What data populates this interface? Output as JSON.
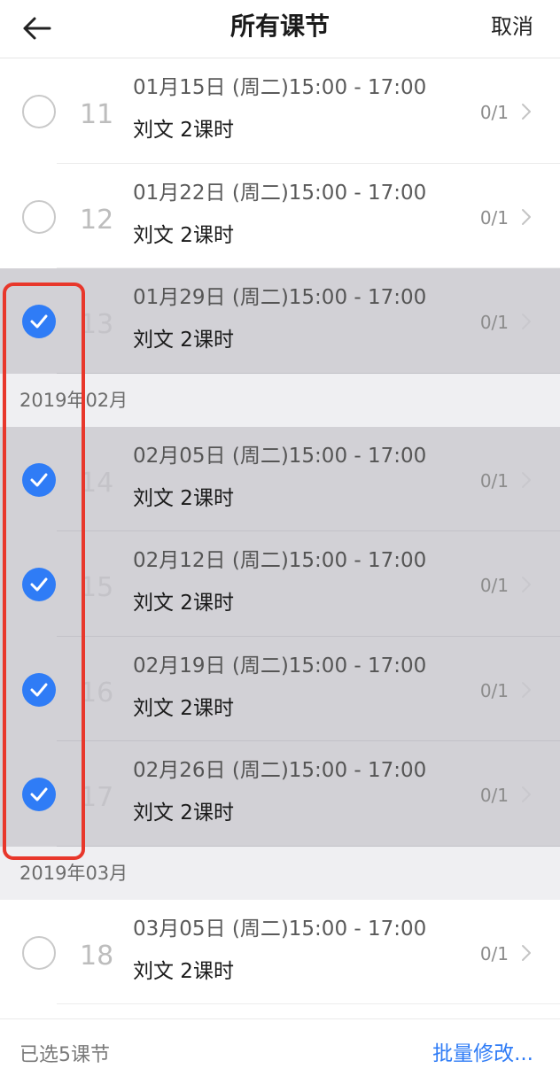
{
  "header": {
    "title": "所有课节",
    "cancel_label": "取消"
  },
  "lessons_a": [
    {
      "num": "11",
      "date": "01月15日 (周二)15:00 - 17:00",
      "teacher": "刘文  2课时",
      "count": "0/1",
      "selected": false
    },
    {
      "num": "12",
      "date": "01月22日 (周二)15:00 - 17:00",
      "teacher": "刘文  2课时",
      "count": "0/1",
      "selected": false
    },
    {
      "num": "13",
      "date": "01月29日 (周二)15:00 - 17:00",
      "teacher": "刘文  2课时",
      "count": "0/1",
      "selected": true
    }
  ],
  "month_feb": "2019年02月",
  "lessons_b": [
    {
      "num": "14",
      "date": "02月05日 (周二)15:00 - 17:00",
      "teacher": "刘文  2课时",
      "count": "0/1",
      "selected": true
    },
    {
      "num": "15",
      "date": "02月12日 (周二)15:00 - 17:00",
      "teacher": "刘文  2课时",
      "count": "0/1",
      "selected": true
    },
    {
      "num": "16",
      "date": "02月19日 (周二)15:00 - 17:00",
      "teacher": "刘文  2课时",
      "count": "0/1",
      "selected": true
    },
    {
      "num": "17",
      "date": "02月26日 (周二)15:00 - 17:00",
      "teacher": "刘文  2课时",
      "count": "0/1",
      "selected": true
    }
  ],
  "month_mar": "2019年03月",
  "lessons_c": [
    {
      "num": "18",
      "date": "03月05日 (周二)15:00 - 17:00",
      "teacher": "刘文  2课时",
      "count": "0/1",
      "selected": false
    }
  ],
  "footer": {
    "selected_text": "已选5课节",
    "batch_label": "批量修改..."
  },
  "colors": {
    "accent": "#2f7cf6",
    "selected_row": "#d2d1d6",
    "annotation": "#e8372b"
  }
}
